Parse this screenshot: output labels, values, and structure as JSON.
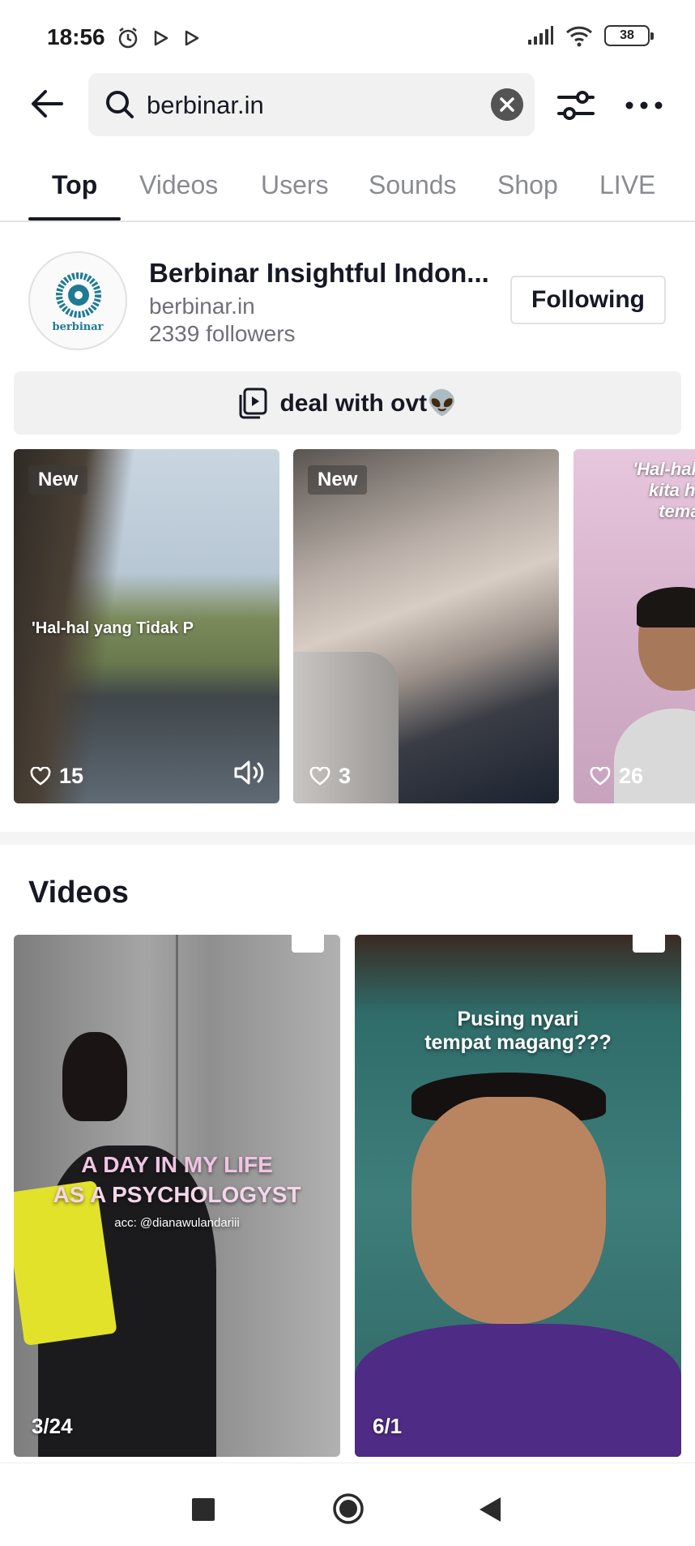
{
  "status_bar": {
    "time": "18:56",
    "battery": "38"
  },
  "search": {
    "query": "berbinar.in"
  },
  "tabs": [
    {
      "label": "Top",
      "active": true
    },
    {
      "label": "Videos",
      "active": false
    },
    {
      "label": "Users",
      "active": false
    },
    {
      "label": "Sounds",
      "active": false
    },
    {
      "label": "Shop",
      "active": false
    },
    {
      "label": "LIVE",
      "active": false
    }
  ],
  "user": {
    "name": "Berbinar Insightful Indon...",
    "handle": "berbinar.in",
    "followers": "2339 followers",
    "follow_button": "Following",
    "avatar_text": "berbinar"
  },
  "playlist": {
    "label": "deal with ovt👽"
  },
  "cards": [
    {
      "badge": "New",
      "likes": "15",
      "overlay": "'Hal-hal yang Tidak P"
    },
    {
      "badge": "New",
      "likes": "3",
      "overlay": ""
    },
    {
      "badge": "",
      "likes": "26",
      "overlay": "'Hal-hal y\nkita hin\nteman"
    }
  ],
  "videos_section": {
    "title": "Videos",
    "items": [
      {
        "date": "3/24",
        "title_line1": "A DAY IN MY LIFE",
        "title_line2": "AS A PSYCHOLOGYST",
        "caption": "acc: @dianawulandariii"
      },
      {
        "date": "6/1",
        "title_line1": "Pusing nyari",
        "title_line2": "tempat magang???",
        "caption": ""
      }
    ]
  },
  "colors": {
    "text_primary": "#161823",
    "text_secondary": "#8a8b91",
    "surface": "#f1f1f2",
    "brand_teal": "#1f7a93"
  }
}
